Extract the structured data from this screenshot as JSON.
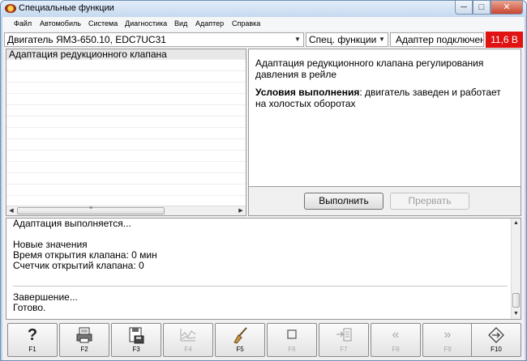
{
  "window": {
    "title": "Специальные функции",
    "buttons": {
      "minimize": "─",
      "maximize": "□",
      "close": "✕"
    }
  },
  "menu": [
    "Файл",
    "Автомобиль",
    "Система",
    "Диагностика",
    "Вид",
    "Адаптер",
    "Справка"
  ],
  "toolbar": {
    "engine": "Двигатель ЯМЗ-650.10, EDC7UC31",
    "mode": "Спец. функции",
    "adapter_status": "Адаптер подключен",
    "voltage": "11,6 В"
  },
  "function_list": {
    "items": [
      "Адаптация редукционного клапана"
    ],
    "selected_index": 0
  },
  "description": {
    "text": "Адаптация редукционного клапана регулирования давления в рейле",
    "conditions_label": "Условия выполнения",
    "conditions_text": ": двигатель заведен и работает на холостых оборотах"
  },
  "actions": {
    "run": "Выполнить",
    "abort": "Прервать"
  },
  "log": {
    "lines_top": [
      "Адаптация выполняется...",
      "",
      "Новые значения",
      "Время открытия клапана: 0 мин",
      "Счетчик открытий клапана: 0"
    ],
    "lines_bottom": [
      "Завершение...",
      "Готово."
    ]
  },
  "fkeys": [
    {
      "label": "F1",
      "icon": "help-icon",
      "enabled": true
    },
    {
      "label": "F2",
      "icon": "print-icon",
      "enabled": true
    },
    {
      "label": "F3",
      "icon": "save-icon",
      "enabled": true
    },
    {
      "label": "F4",
      "icon": "chart-icon",
      "enabled": false
    },
    {
      "label": "F5",
      "icon": "broom-icon",
      "enabled": true
    },
    {
      "label": "F6",
      "icon": "stop-icon",
      "enabled": false
    },
    {
      "label": "F7",
      "icon": "import-icon",
      "enabled": false
    },
    {
      "label": "F8",
      "icon": "rewind-icon",
      "enabled": false
    },
    {
      "label": "F9",
      "icon": "forward-icon",
      "enabled": false
    },
    {
      "label": "F10",
      "icon": "exit-icon",
      "enabled": true
    }
  ],
  "colors": {
    "voltage_bg": "#e01212",
    "accent": "#bcd2ea"
  }
}
